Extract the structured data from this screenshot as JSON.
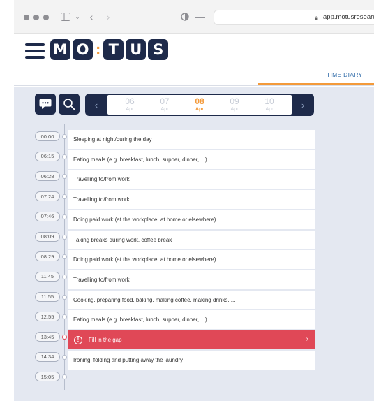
{
  "browser": {
    "url": "app.motusresearch."
  },
  "logo": {
    "letters": [
      "M",
      "O",
      "T",
      "U",
      "S"
    ],
    "separator": ":"
  },
  "header": {
    "tab_label": "TIME DIARY"
  },
  "dates": [
    {
      "day": "06",
      "month": "Apr",
      "selected": false
    },
    {
      "day": "07",
      "month": "Apr",
      "selected": false
    },
    {
      "day": "08",
      "month": "Apr",
      "selected": true
    },
    {
      "day": "09",
      "month": "Apr",
      "selected": false
    },
    {
      "day": "10",
      "month": "Apr",
      "selected": false
    }
  ],
  "timeline": [
    {
      "time": "00:00",
      "activity": "Sleeping at night/during the day"
    },
    {
      "time": "06:15",
      "activity": "Eating meals (e.g. breakfast, lunch, supper, dinner, ...)"
    },
    {
      "time": "06:28",
      "activity": "Travelling to/from work"
    },
    {
      "time": "07:24",
      "activity": "Travelling to/from work"
    },
    {
      "time": "07:46",
      "activity": "Doing paid work (at the workplace, at home or elsewhere)"
    },
    {
      "time": "08:09",
      "activity": "Taking breaks during work, coffee break"
    },
    {
      "time": "08:29",
      "activity": "Doing paid work (at the workplace, at home or elsewhere)"
    },
    {
      "time": "11:45",
      "activity": "Travelling to/from work"
    },
    {
      "time": "11:55",
      "activity": "Cooking, preparing food, baking, making coffee, making drinks, ..."
    },
    {
      "time": "12:55",
      "activity": "Eating meals (e.g. breakfast, lunch, supper, dinner, ...)"
    },
    {
      "time": "13:45",
      "activity": "Fill in the gap",
      "gap": true
    },
    {
      "time": "14:34",
      "activity": "Ironing, folding and putting away the laundry"
    },
    {
      "time": "15:05",
      "activity": ""
    }
  ],
  "colors": {
    "navy": "#1e2a4a",
    "accent_orange": "#f39a3b",
    "gap_red": "#e04857",
    "background": "#e4e8f1"
  },
  "icons": {
    "chat": "chat-bubble-icon",
    "search": "search-icon",
    "prev": "chevron-left-icon",
    "next": "chevron-right-icon",
    "gap": "exclamation-circle-icon"
  }
}
